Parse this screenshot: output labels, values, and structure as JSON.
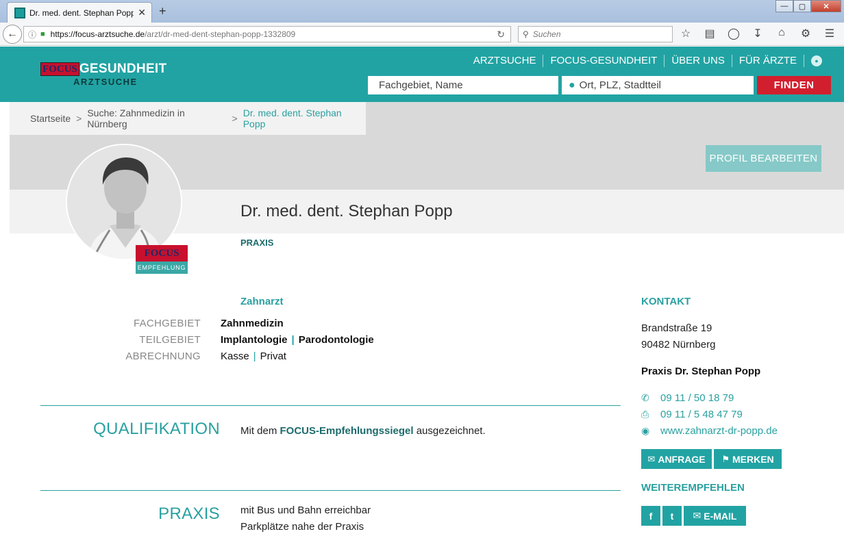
{
  "browser": {
    "tab_title": "Dr. med. dent. Stephan Popp",
    "new_tab": "+",
    "close_tab": "✕",
    "url_host": "https://focus-arztsuche.de",
    "url_path": "/arzt/dr-med-dent-stephan-popp-1332809",
    "search_placeholder": "Suchen",
    "window_buttons": {
      "minimize": "—",
      "maximize": "▢",
      "close": "✕"
    }
  },
  "header": {
    "logo_focus": "FOCUS",
    "logo_gesundheit": "GESUNDHEIT",
    "logo_sub": "ARZTSUCHE",
    "nav": [
      "ARZTSUCHE",
      "FOCUS-GESUNDHEIT",
      "ÜBER UNS",
      "FÜR ÄRZTE"
    ],
    "search_field_1": "Fachgebiet, Name",
    "search_field_2": "Ort, PLZ, Stadtteil",
    "search_button": "FINDEN"
  },
  "breadcrumb": {
    "items": [
      "Startseite",
      "Suche: Zahnmedizin in Nürnberg",
      "Dr. med. dent. Stephan Popp"
    ],
    "separator": ">"
  },
  "profile": {
    "edit_button": "PROFIL BEARBEITEN",
    "name": "Dr. med. dent. Stephan Popp",
    "type_label": "PRAXIS",
    "seal_top": "FOCUS",
    "seal_bottom": "EMPFEHLUNG",
    "specialty_title": "Zahnarzt",
    "details": {
      "fachgebiet_label": "FACHGEBIET",
      "fachgebiet_value": "Zahnmedizin",
      "teilgebiet_label": "TEILGEBIET",
      "teilgebiet_values": [
        "Implantologie",
        "Parodontologie"
      ],
      "abrechnung_label": "ABRECHNUNG",
      "abrechnung_values": [
        "Kasse",
        "Privat"
      ]
    },
    "qualifikation_title": "QUALIFIKATION",
    "qualifikation_pre": "Mit dem",
    "qualifikation_link": "FOCUS-Empfehlungssiegel",
    "qualifikation_post": "ausgezeichnet.",
    "praxis_title": "PRAXIS",
    "praxis_lines": [
      "mit Bus und Bahn erreichbar",
      "Parkplätze nahe der Praxis"
    ]
  },
  "kontakt": {
    "title": "KONTAKT",
    "street": "Brandstraße 19",
    "city": "90482 Nürnberg",
    "praxis_name": "Praxis Dr. Stephan Popp",
    "phone": "09 11 / 50 18 79",
    "fax": "09 11 / 5 48 47 79",
    "website": "www.zahnarzt-dr-popp.de",
    "btn_anfrage": "ANFRAGE",
    "btn_merken": "MERKEN",
    "weiter_title": "WEITEREMPFEHLEN",
    "share_fb": "f",
    "share_tw": "t",
    "share_mail": "E-MAIL"
  },
  "colors": {
    "accent": "#22a3a3",
    "finden": "#d21f2e",
    "focus_red": "#c8102e"
  }
}
